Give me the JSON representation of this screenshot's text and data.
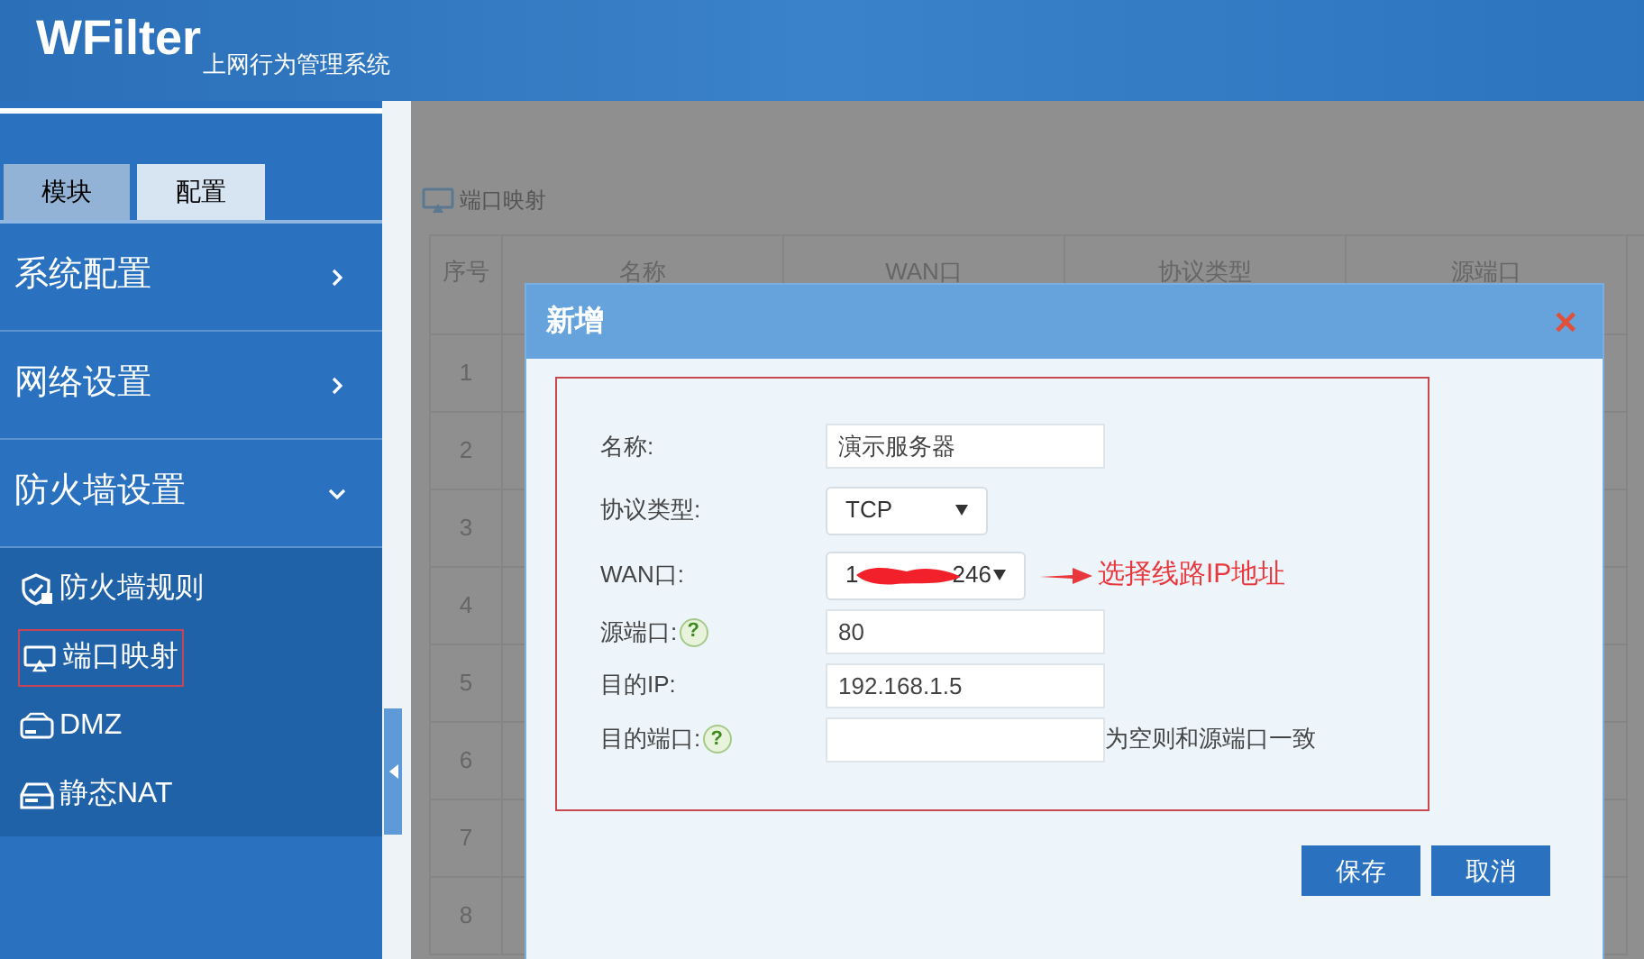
{
  "header": {
    "logo": "WFilter",
    "subtitle": "上网行为管理系统"
  },
  "sidebar": {
    "tabs": [
      {
        "label": "模块",
        "selected": false
      },
      {
        "label": "配置",
        "selected": true
      }
    ],
    "menu": [
      {
        "label": "系统配置",
        "expanded": false
      },
      {
        "label": "网络设置",
        "expanded": false
      },
      {
        "label": "防火墙设置",
        "expanded": true,
        "children": [
          {
            "label": "防火墙规则",
            "kind": "shield",
            "selected": false
          },
          {
            "label": "端口映射",
            "kind": "monitor",
            "selected": true
          },
          {
            "label": "DMZ",
            "kind": "server",
            "selected": false
          },
          {
            "label": "静态NAT",
            "kind": "drive",
            "selected": false
          }
        ]
      }
    ]
  },
  "page_title": "端口映射",
  "table": {
    "columns": [
      "序号",
      "名称",
      "WAN口",
      "协议类型",
      "源端口"
    ],
    "rows": [
      "1",
      "2",
      "3",
      "4",
      "5",
      "6",
      "7",
      "8"
    ]
  },
  "dialog": {
    "title": "新增",
    "close": "×",
    "fields": [
      {
        "label": "名称:",
        "kind": "text",
        "value": "演示服务器"
      },
      {
        "label": "协议类型:",
        "kind": "select",
        "value": "TCP"
      },
      {
        "label": "WAN口:",
        "kind": "redacted_select",
        "value_start": "1",
        "value_end": "246",
        "annotation": "选择线路IP地址"
      },
      {
        "label": "源端口:",
        "kind": "text",
        "value": "80",
        "help": "?"
      },
      {
        "label": "目的IP:",
        "kind": "text",
        "value": "192.168.1.5"
      },
      {
        "label": "目的端口:",
        "kind": "text",
        "help": "?",
        "note": "为空则和源端口一致"
      }
    ],
    "buttons": [
      "保存",
      "取消"
    ]
  }
}
